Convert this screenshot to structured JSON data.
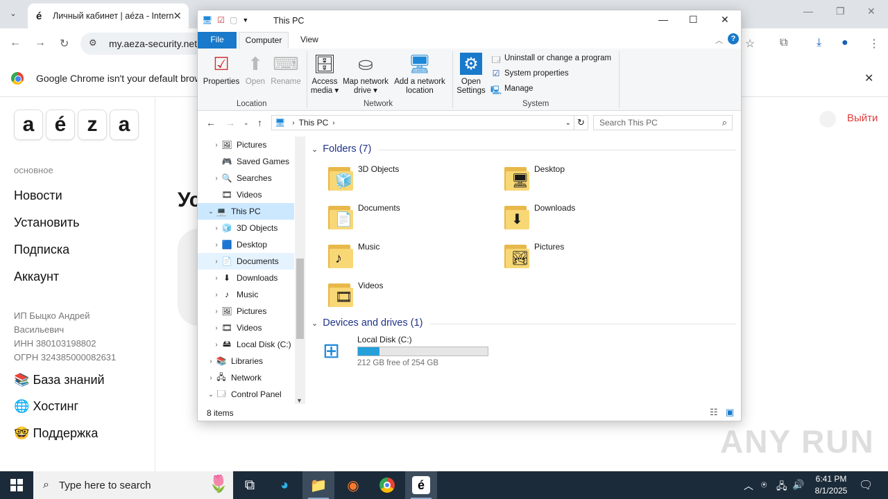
{
  "chrome": {
    "tab_title": "Личный кабинет | aéza - Intern",
    "tab_favicon": "é",
    "url": "my.aeza-security.net",
    "infobar_message": "Google Chrome isn't your default browser"
  },
  "page": {
    "logo_letters": [
      "a",
      "é",
      "z",
      "a"
    ],
    "section_label": "основное",
    "nav_items": [
      "Новости",
      "Установить",
      "Подписка",
      "Аккаунт"
    ],
    "company_lines": [
      "ИП Быцко Андрей",
      "Васильевич",
      "ИНН 380103198802",
      "ОГРН 324385000082631"
    ],
    "links": [
      {
        "icon": "📚",
        "label": "База знаний"
      },
      {
        "icon": "🌐",
        "label": "Хостинг"
      },
      {
        "icon": "🤓",
        "label": "Поддержка"
      }
    ],
    "heading_partial": "Ус",
    "logout_label": "Выйти",
    "watermark": "ANY RUN"
  },
  "explorer": {
    "title": "This PC",
    "ribbon_tabs": [
      "File",
      "Computer",
      "View"
    ],
    "ribbon": {
      "location": {
        "label": "Location",
        "buttons": [
          "Properties",
          "Open",
          "Rename"
        ]
      },
      "network": {
        "label": "Network",
        "buttons": [
          [
            "Access",
            "media ▾"
          ],
          [
            "Map network",
            "drive ▾"
          ],
          [
            "Add a network",
            "location"
          ]
        ]
      },
      "system": {
        "label": "System",
        "open_settings": [
          "Open",
          "Settings"
        ],
        "items": [
          "Uninstall or change a program",
          "System properties",
          "Manage"
        ]
      }
    },
    "address": {
      "path": "This PC",
      "search_placeholder": "Search This PC"
    },
    "nav_tree": [
      {
        "label": "Pictures",
        "icon": "pictures-icon",
        "glyph": "🖼",
        "indent": 1,
        "expand": true
      },
      {
        "label": "Saved Games",
        "icon": "saved-games-icon",
        "glyph": "🎮",
        "indent": 1,
        "expand": false
      },
      {
        "label": "Searches",
        "icon": "searches-icon",
        "glyph": "🔍",
        "indent": 1,
        "expand": true
      },
      {
        "label": "Videos",
        "icon": "videos-icon",
        "glyph": "🎞",
        "indent": 1,
        "expand": false
      },
      {
        "label": "This PC",
        "icon": "this-pc-icon",
        "glyph": "💻",
        "indent": 0,
        "expand": "open",
        "selected": true
      },
      {
        "label": "3D Objects",
        "icon": "3d-objects-icon",
        "glyph": "🧊",
        "indent": 1,
        "expand": true
      },
      {
        "label": "Desktop",
        "icon": "desktop-icon",
        "glyph": "🟦",
        "indent": 1,
        "expand": true
      },
      {
        "label": "Documents",
        "icon": "documents-icon",
        "glyph": "📄",
        "indent": 1,
        "expand": true,
        "hover": true
      },
      {
        "label": "Downloads",
        "icon": "downloads-icon",
        "glyph": "⬇",
        "indent": 1,
        "expand": true
      },
      {
        "label": "Music",
        "icon": "music-icon",
        "glyph": "♪",
        "indent": 1,
        "expand": true
      },
      {
        "label": "Pictures",
        "icon": "pictures-icon",
        "glyph": "🖼",
        "indent": 1,
        "expand": true
      },
      {
        "label": "Videos",
        "icon": "videos-icon",
        "glyph": "🎞",
        "indent": 1,
        "expand": true
      },
      {
        "label": "Local Disk (C:)",
        "icon": "local-disk-icon",
        "glyph": "🖴",
        "indent": 1,
        "expand": true
      },
      {
        "label": "Libraries",
        "icon": "libraries-icon",
        "glyph": "📚",
        "indent": 0,
        "expand": true
      },
      {
        "label": "Network",
        "icon": "network-icon",
        "glyph": "🖧",
        "indent": 0,
        "expand": true
      },
      {
        "label": "Control Panel",
        "icon": "control-panel-icon",
        "glyph": "🗔",
        "indent": 0,
        "expand": "open"
      }
    ],
    "folders_header": "Folders (7)",
    "folders": [
      {
        "label": "3D Objects",
        "overlay": "🧊"
      },
      {
        "label": "Desktop",
        "overlay": "🖥"
      },
      {
        "label": "Documents",
        "overlay": "📄"
      },
      {
        "label": "Downloads",
        "overlay": "⬇"
      },
      {
        "label": "Music",
        "overlay": "♪"
      },
      {
        "label": "Pictures",
        "overlay": "🏞"
      },
      {
        "label": "Videos",
        "overlay": "🎞"
      }
    ],
    "devices_header": "Devices and drives (1)",
    "drive": {
      "name": "Local Disk (C:)",
      "free_text": "212 GB free of 254 GB",
      "used_fraction": 0.165
    },
    "status": "8 items"
  },
  "taskbar": {
    "search_placeholder": "Type here to search",
    "time": "6:41 PM",
    "date": "8/1/2025"
  },
  "colors": {
    "accent": "#1979ca",
    "logout": "#e03c3c",
    "taskbar": "#1c2b3a",
    "drive_fill": "#26a0da"
  }
}
